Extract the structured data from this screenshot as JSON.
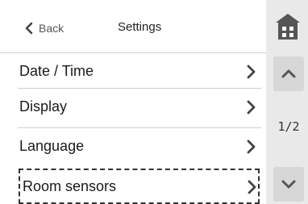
{
  "header": {
    "back_label": "Back",
    "title": "Settings",
    "home_icon": "home-icon"
  },
  "menu": {
    "items": [
      {
        "label": "Date / Time",
        "icon": "chevron-right-icon"
      },
      {
        "label": "Display",
        "icon": "chevron-right-icon"
      },
      {
        "label": "Language",
        "icon": "chevron-right-icon"
      },
      {
        "label": "Room sensors",
        "icon": "chevron-right-icon",
        "selected": true
      }
    ]
  },
  "pager": {
    "indicator": "1/2",
    "up_icon": "chevron-up-icon",
    "down_icon": "chevron-down-icon"
  },
  "colors": {
    "background": "#e9e9e9",
    "panel": "#ffffff",
    "pager_button": "#d7d7d7",
    "icon": "#555555"
  }
}
